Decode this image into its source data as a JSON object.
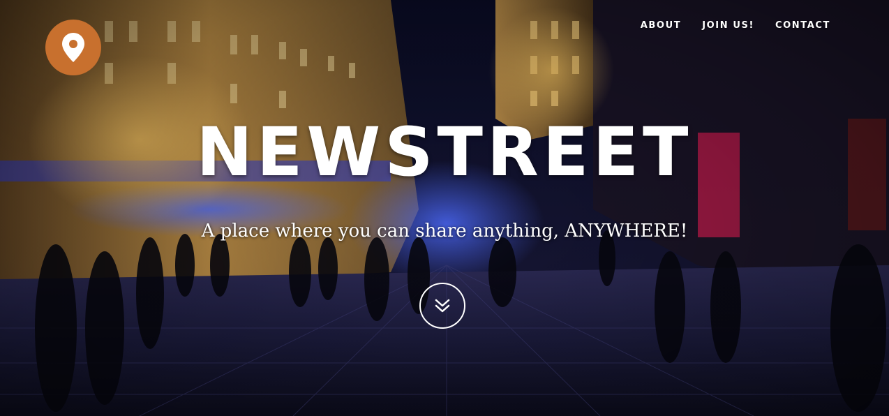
{
  "nav": {
    "items": [
      {
        "label": "ABOUT"
      },
      {
        "label": "JOIN US!"
      },
      {
        "label": "CONTACT"
      }
    ]
  },
  "hero": {
    "title": "NEWSTREET",
    "subtitle": "A place where you can share anything, ANYWHERE!"
  },
  "icons": {
    "logo": "map-pin-icon",
    "scroll": "double-chevron-down-icon"
  },
  "colors": {
    "logo_bg": "#c8702e",
    "text": "#ffffff"
  }
}
